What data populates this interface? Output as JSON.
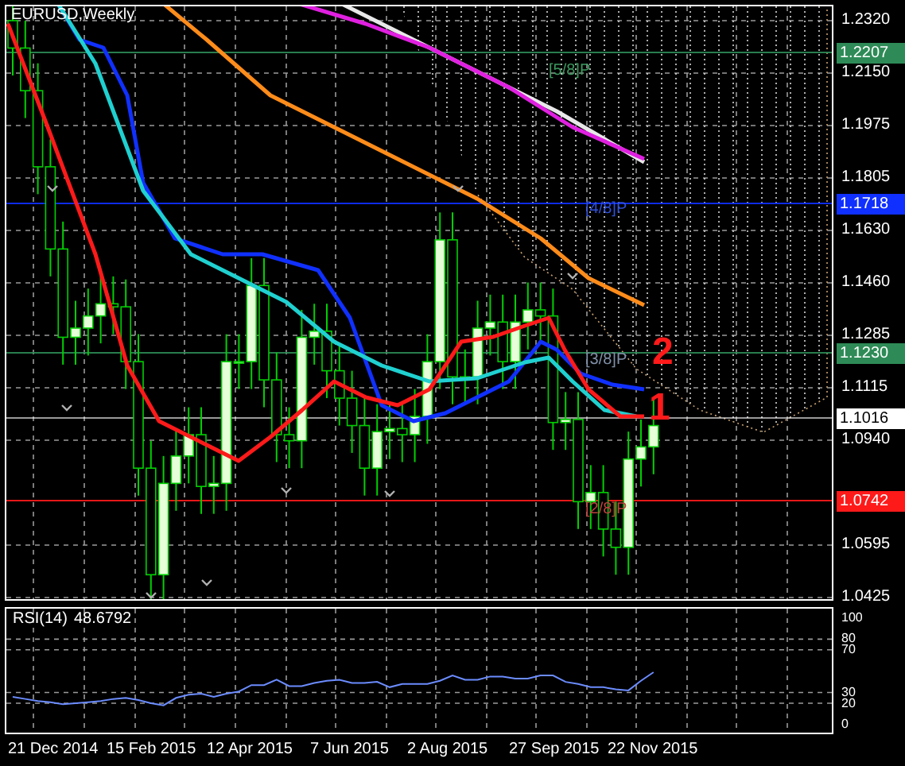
{
  "chart": {
    "title": "EURUSD,Weekly",
    "price_ticks": [
      "1.2320",
      "1.2150",
      "1.1975",
      "1.1805",
      "1.1630",
      "1.1460",
      "1.1285",
      "1.1115",
      "1.0940",
      "1.0595",
      "1.0425"
    ],
    "price_badges": [
      {
        "text": "1.2207",
        "color": "#2e8b57"
      },
      {
        "text": "1.1718",
        "color": "#1030ff"
      },
      {
        "text": "1.1230",
        "color": "#2e8b57"
      },
      {
        "text": "1.1016",
        "color": "#ffffff"
      },
      {
        "text": "1.0742",
        "color": "#ff1a1a"
      }
    ],
    "level_labels": [
      {
        "text": "[5/8]P",
        "color": "#3c9a5f"
      },
      {
        "text": "[4/8]P",
        "color": "#3050d8"
      },
      {
        "text": "[3/8]P",
        "color": "#8090a8"
      },
      {
        "text": "[2/8]P",
        "color": "#c04040"
      }
    ],
    "hand_marks": [
      "2",
      "1"
    ]
  },
  "rsi": {
    "value": "48.6792",
    "chart_data": {
      "type": "line",
      "grid": true,
      "ylim": [
        -9,
        110
      ],
      "yticks": [
        {
          "value": 0,
          "label": "0"
        },
        {
          "value": 20,
          "label": "20"
        },
        {
          "value": 30,
          "label": "30"
        },
        {
          "value": 70,
          "label": "70"
        },
        {
          "value": 80,
          "label": "80"
        },
        {
          "value": 100,
          "label": "100"
        }
      ],
      "series": [
        {
          "name": "RSI(14)",
          "color": "#6b8cff",
          "values": [
            26,
            24,
            22,
            21,
            19,
            20,
            21,
            22,
            24,
            25,
            23,
            20,
            18,
            25,
            28,
            29,
            26,
            29,
            31,
            37,
            37,
            42,
            36,
            36,
            39,
            41,
            42,
            39,
            39,
            40,
            35,
            38,
            38,
            38,
            41,
            46,
            42,
            42,
            45,
            45,
            43,
            43,
            46,
            46,
            40,
            38,
            35,
            35,
            33,
            32,
            41,
            49
          ]
        }
      ]
    }
  },
  "time_axis": [
    "21 Dec 2014",
    "15 Feb 2015",
    "12 Apr 2015",
    "7 Jun 2015",
    "2 Aug 2015",
    "27 Sep 2015",
    "22 Nov 2015"
  ]
}
